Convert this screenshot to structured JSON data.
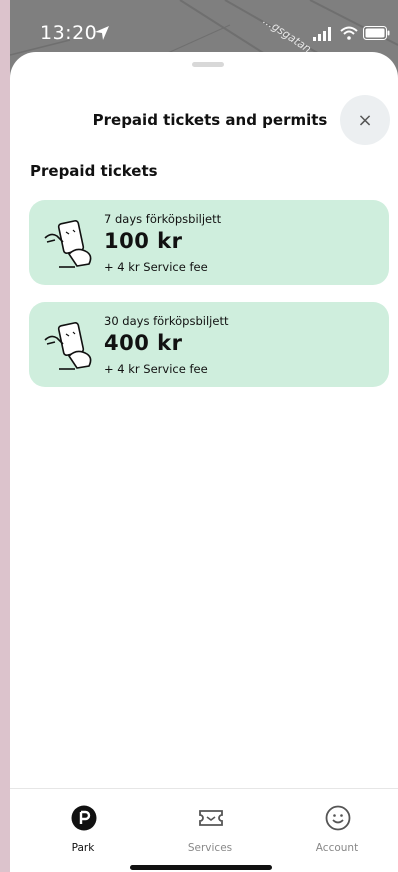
{
  "status_bar": {
    "time": "13:20",
    "street_label": "...gsgatan",
    "icons": [
      "location-arrow-icon",
      "signal-icon",
      "wifi-icon",
      "battery-icon"
    ]
  },
  "sheet": {
    "title": "Prepaid tickets and permits",
    "close_label": "×"
  },
  "section": {
    "title": "Prepaid tickets"
  },
  "tickets": [
    {
      "name": "7 days förköpsbiljett",
      "price": "100  kr",
      "fee": "+ 4  kr Service fee"
    },
    {
      "name": "30 days förköpsbiljett",
      "price": "400  kr",
      "fee": "+ 4  kr Service fee"
    }
  ],
  "tabs": [
    {
      "label": "Park",
      "icon": "park-p-icon",
      "active": true
    },
    {
      "label": "Services",
      "icon": "ticket-icon",
      "active": false
    },
    {
      "label": "Account",
      "icon": "smiley-icon",
      "active": false
    }
  ],
  "colors": {
    "ticket_bg": "#cfeedd",
    "overlay_bg": "#7f7f7f",
    "active_tab": "#111111",
    "inactive_tab": "#888888"
  }
}
